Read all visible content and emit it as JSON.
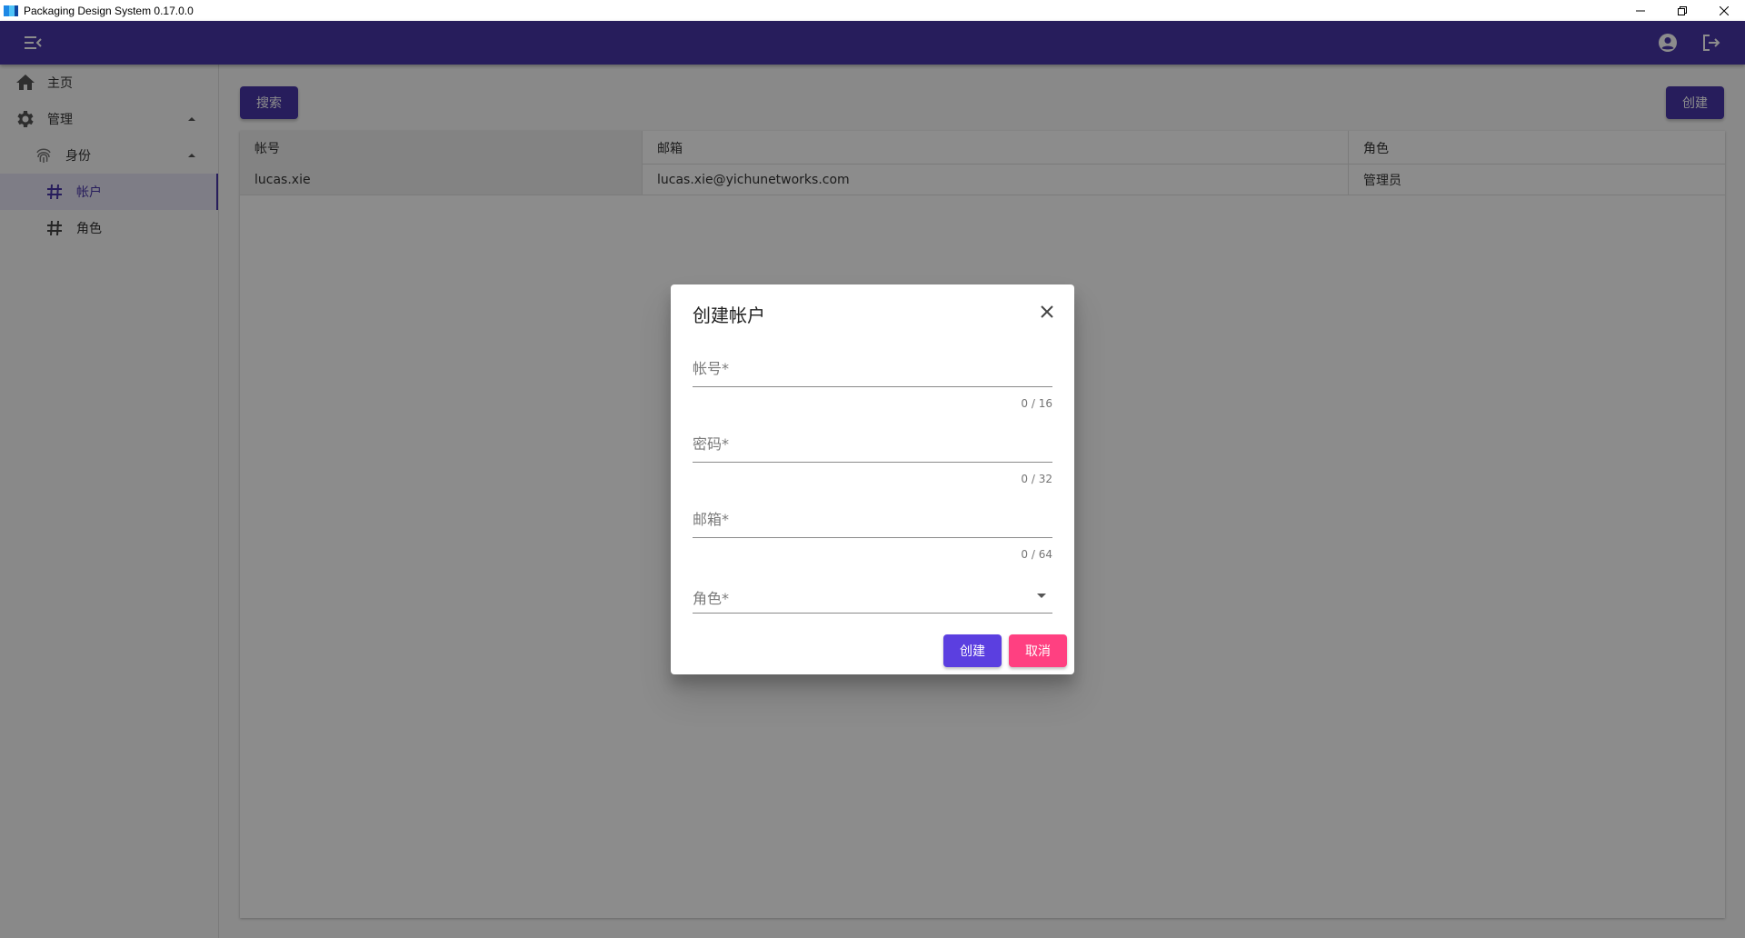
{
  "window": {
    "title": "Packaging Design System 0.17.0.0",
    "controls": [
      "minimize-icon",
      "restore-icon",
      "close-icon"
    ]
  },
  "appbar": {
    "color": "#4836a8",
    "icons": [
      "menu-collapse-icon",
      "account-circle-icon",
      "logout-icon"
    ]
  },
  "sidebar": {
    "items": [
      {
        "label": "主页",
        "icon": "home-icon"
      },
      {
        "label": "管理",
        "icon": "gear-icon",
        "expanded": true
      },
      {
        "label": "身份",
        "icon": "fingerprint-icon",
        "expanded": true
      },
      {
        "label": "帐户",
        "icon": "hash-icon",
        "active": true
      },
      {
        "label": "角色",
        "icon": "hash-icon"
      }
    ]
  },
  "toolbar": {
    "search_label": "搜索",
    "create_label": "创建"
  },
  "table": {
    "columns": [
      "帐号",
      "邮箱",
      "角色"
    ],
    "rows": [
      [
        "lucas.xie",
        "lucas.xie@yichunetworks.com",
        "管理员"
      ]
    ]
  },
  "dialog": {
    "title": "创建帐户",
    "fields": {
      "account": {
        "placeholder": "帐号*",
        "value": "",
        "counter": "0 / 16"
      },
      "password": {
        "placeholder": "密码*",
        "value": "",
        "counter": "0 / 32"
      },
      "email": {
        "placeholder": "邮箱*",
        "value": "",
        "counter": "0 / 64"
      },
      "role": {
        "placeholder": "角色*",
        "value": ""
      }
    },
    "create_label": "创建",
    "cancel_label": "取消",
    "create_color": "#5b3fe0",
    "cancel_color": "#ff4081"
  }
}
